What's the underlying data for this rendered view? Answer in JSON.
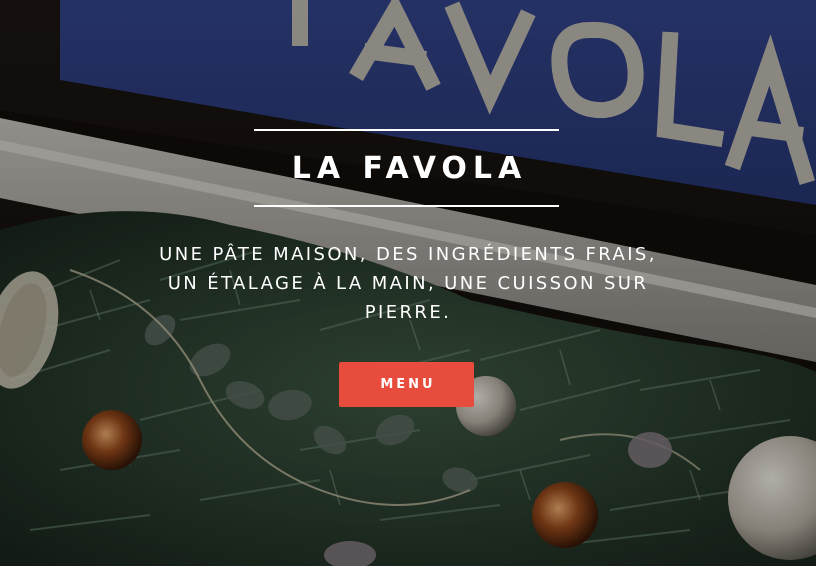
{
  "hero": {
    "title": "LA FAVOLA",
    "tagline": "UNE PÂTE MAISON, DES INGRÉDIENTS FRAIS, UN ÉTALAGE À LA MAIN, UNE CUISSON SUR PIERRE.",
    "menu_button_label": "MENU",
    "sign_text": "LA FAVOLA"
  },
  "colors": {
    "button": "#e84c3d",
    "text": "#ffffff",
    "sign_blue": "#2f3f86"
  }
}
